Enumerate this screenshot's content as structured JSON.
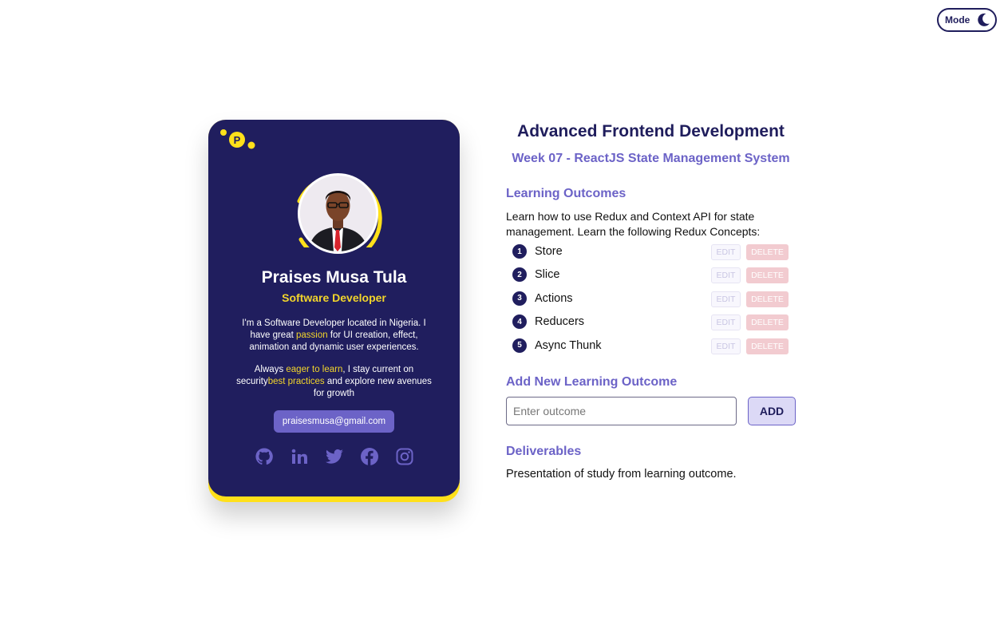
{
  "mode_toggle": {
    "label": "Mode",
    "icon": "moon-icon"
  },
  "profile": {
    "name": "Praises Musa Tula",
    "role": "Software Developer",
    "bio1": {
      "pre": "I'm a Software Developer located in Nigeria. I have great ",
      "highlight": "passion",
      "post": " for UI creation, effect, animation and dynamic user experiences."
    },
    "bio2": {
      "pre": "Always ",
      "highlight1": "eager to learn",
      "mid": ", I stay current on security",
      "highlight2": "best practices",
      "post": " and explore new avenues for growth"
    },
    "email": "praisesmusa@gmail.com",
    "socials": [
      "github-icon",
      "linkedin-icon",
      "twitter-icon",
      "facebook-icon",
      "instagram-icon"
    ],
    "logo_letter": "P"
  },
  "course": {
    "title": "Advanced Frontend Development",
    "week": "Week 07 - ReactJS State Management System"
  },
  "learning_outcomes": {
    "heading": "Learning Outcomes",
    "description": "Learn how to use Redux and Context API for state management. Learn the following Redux Concepts:",
    "items": [
      {
        "num": "1",
        "label": "Store",
        "edit": "EDIT",
        "delete": "DELETE"
      },
      {
        "num": "2",
        "label": "Slice",
        "edit": "EDIT",
        "delete": "DELETE"
      },
      {
        "num": "3",
        "label": "Actions",
        "edit": "EDIT",
        "delete": "DELETE"
      },
      {
        "num": "4",
        "label": "Reducers",
        "edit": "EDIT",
        "delete": "DELETE"
      },
      {
        "num": "5",
        "label": "Async Thunk",
        "edit": "EDIT",
        "delete": "DELETE"
      }
    ]
  },
  "add_outcome": {
    "heading": "Add New Learning Outcome",
    "placeholder": "Enter outcome",
    "button": "ADD"
  },
  "deliverables": {
    "heading": "Deliverables",
    "text": "Presentation of study from learning outcome."
  },
  "colors": {
    "navy": "#201e5e",
    "accent_purple": "#6c63c7",
    "yellow": "#ffe01a",
    "delete_pink": "#f2cbd0"
  }
}
